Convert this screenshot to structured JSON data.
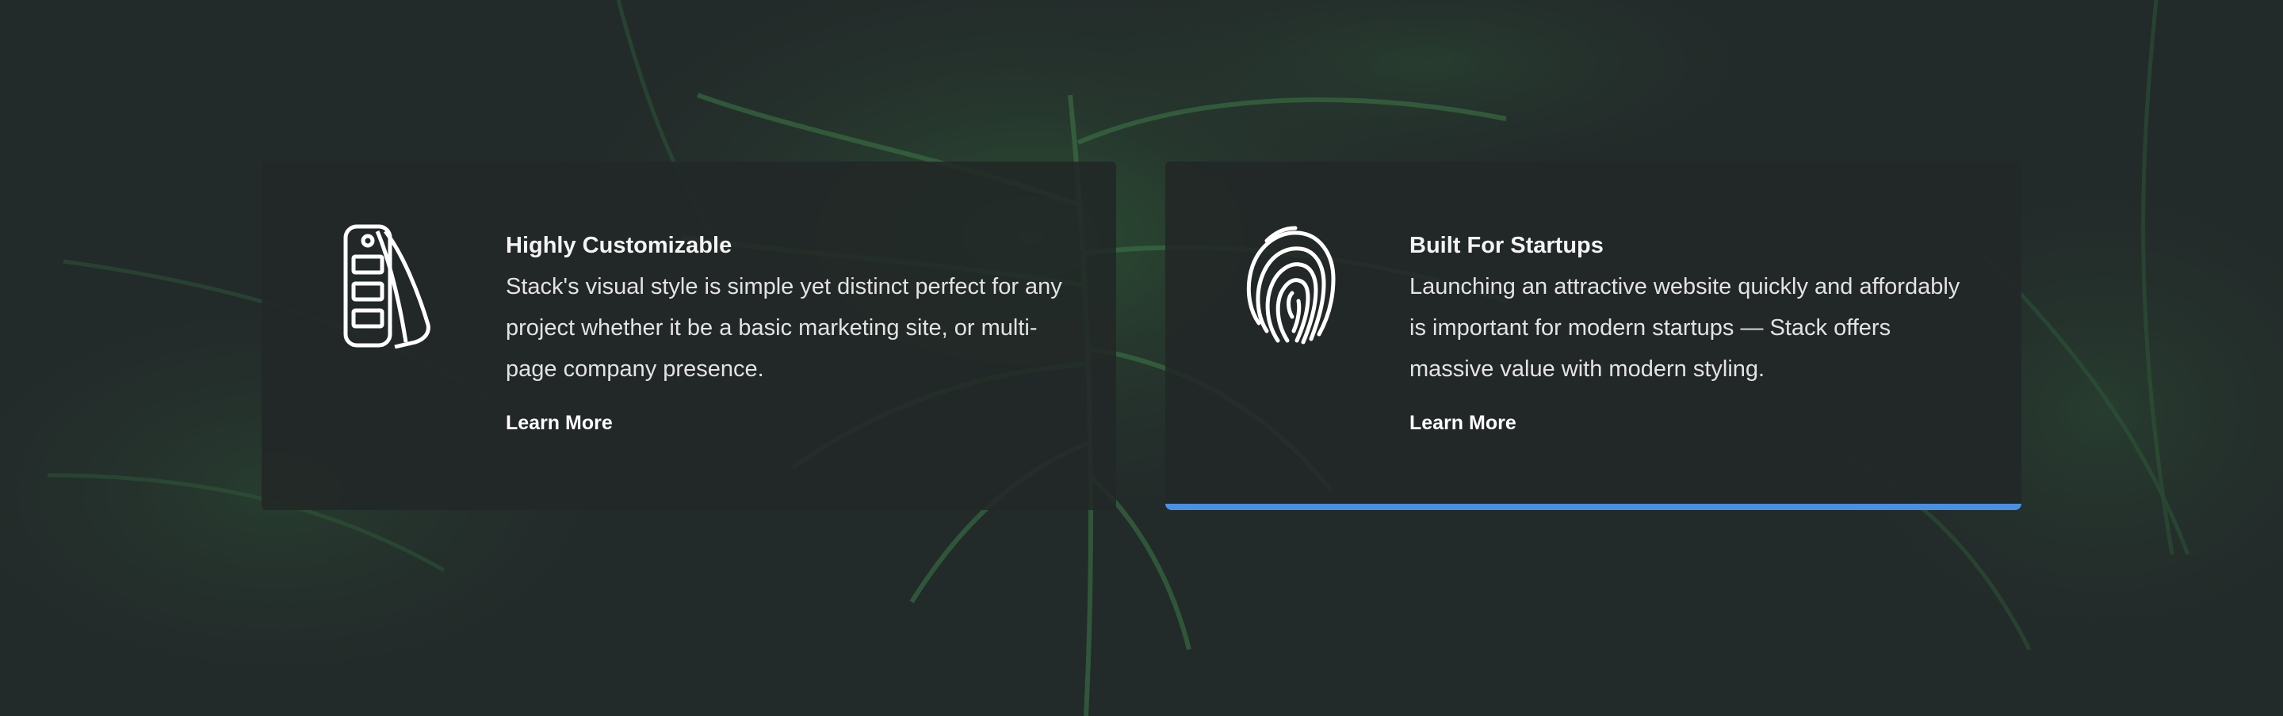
{
  "colors": {
    "background": "#232a2a",
    "card_background": "#222626",
    "accent": "#4a90e2",
    "text": "#ffffff"
  },
  "features": [
    {
      "icon": "color-swatches-icon",
      "title": "Highly Customizable",
      "description": "Stack's visual style is simple yet distinct perfect for any project whether it be a basic marketing site, or multi-page company presence.",
      "link": "Learn More",
      "active": false
    },
    {
      "icon": "fingerprint-icon",
      "title": "Built For Startups",
      "description": "Launching an attractive website quickly and affordably is important for modern startups — Stack offers massive value with modern styling.",
      "link": "Learn More",
      "active": true
    }
  ]
}
